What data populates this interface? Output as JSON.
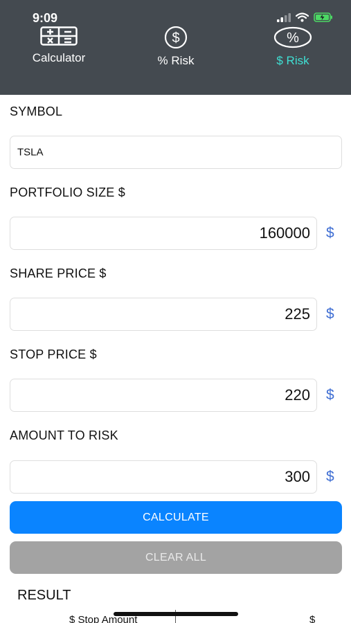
{
  "status_bar": {
    "time": "9:09"
  },
  "tabs": [
    {
      "label": "Calculator",
      "icon": "calculator-icon",
      "active": false
    },
    {
      "label": "% Risk",
      "icon": "dollar-circle-icon",
      "active": false
    },
    {
      "label": "$ Risk",
      "icon": "percent-ellipse-icon",
      "active": true
    }
  ],
  "colors": {
    "header_bg": "#444a50",
    "active_tab": "#3fe0d4",
    "primary_button": "#0a84ff",
    "secondary_button": "#a3a3a3",
    "dollar_suffix": "#3f6ed3"
  },
  "form": {
    "symbol": {
      "label": "SYMBOL",
      "value": "TSLA"
    },
    "portfolio_size": {
      "label": "PORTFOLIO SIZE $",
      "value": "160000",
      "suffix": "$"
    },
    "share_price": {
      "label": "SHARE PRICE $",
      "value": "225",
      "suffix": "$"
    },
    "stop_price": {
      "label": "STOP PRICE $",
      "value": "220",
      "suffix": "$"
    },
    "amount_to_risk": {
      "label": "AMOUNT TO RISK",
      "value": "300",
      "suffix": "$"
    }
  },
  "buttons": {
    "calculate": "CALCULATE",
    "clear_all": "CLEAR ALL"
  },
  "result": {
    "heading": "RESULT",
    "col1": "$ Stop Amount",
    "col2": "$ Shares"
  }
}
